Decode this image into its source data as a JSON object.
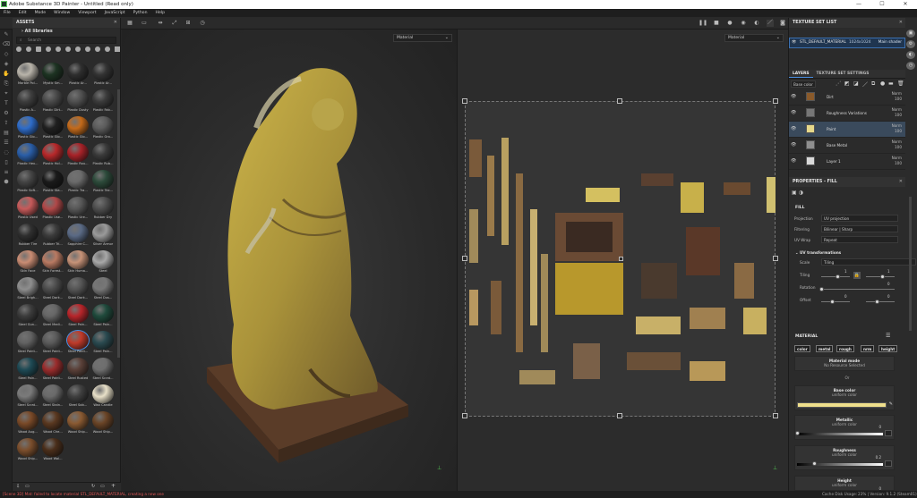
{
  "window": {
    "title": "Adobe Substance 3D Painter - Untitled (Read only)",
    "minimize": "—",
    "maximize": "☐",
    "close": "✕"
  },
  "menu": [
    "File",
    "Edit",
    "Mode",
    "Window",
    "Viewport",
    "JavaScript",
    "Python",
    "Help"
  ],
  "assets": {
    "title": "ASSETS",
    "library": "All libraries",
    "search_placeholder": "Search",
    "items": [
      {
        "label": "Marble Pol...",
        "color": "#b9b4aa"
      },
      {
        "label": "Mystic Sm...",
        "color": "#1d3322"
      },
      {
        "label": "Plastic Ar...",
        "color": "#2e2e2e"
      },
      {
        "label": "Plastic Ar...",
        "color": "#333333"
      },
      {
        "label": "Plastic A...",
        "color": "#3d3d3d"
      },
      {
        "label": "Plastic Dirt...",
        "color": "#4a4a4a"
      },
      {
        "label": "Plastic Dusty",
        "color": "#505050"
      },
      {
        "label": "Plastic Fab...",
        "color": "#3b3b3b"
      },
      {
        "label": "Plastic Glo...",
        "color": "#2e6cc9"
      },
      {
        "label": "Plastic Glo...",
        "color": "#202020"
      },
      {
        "label": "Plastic Glo...",
        "color": "#c46a1a"
      },
      {
        "label": "Plastic Gro...",
        "color": "#5c5c5c"
      },
      {
        "label": "Plastic Hex...",
        "color": "#2a5ea8"
      },
      {
        "label": "Plastic Hol...",
        "color": "#b8282a"
      },
      {
        "label": "Plastic Rou...",
        "color": "#a82228"
      },
      {
        "label": "Plastic Rub...",
        "color": "#3a3a3a"
      },
      {
        "label": "Plastic Soft...",
        "color": "#444444"
      },
      {
        "label": "Plastic Sta...",
        "color": "#1a1a1a"
      },
      {
        "label": "Plastic Tra...",
        "color": "#6b6b6b"
      },
      {
        "label": "Plastic Tex...",
        "color": "#2c4a3a"
      },
      {
        "label": "Plastic Used",
        "color": "#c75a5a"
      },
      {
        "label": "Plastic Use...",
        "color": "#b04848"
      },
      {
        "label": "Plastic Ure...",
        "color": "#575757"
      },
      {
        "label": "Rubber Dry",
        "color": "#4e4e4e"
      },
      {
        "label": "Rubber Tire",
        "color": "#2f2f2f"
      },
      {
        "label": "Rubber Tri...",
        "color": "#3b3b3b"
      },
      {
        "label": "Sapphire C...",
        "color": "#5a6a85"
      },
      {
        "label": "Silver Armor",
        "color": "#9a9a9a"
      },
      {
        "label": "Skin Face",
        "color": "#c98c73"
      },
      {
        "label": "Skin Forest...",
        "color": "#b97a62"
      },
      {
        "label": "Skin Huma...",
        "color": "#c79378"
      },
      {
        "label": "Steel",
        "color": "#a8a8a8"
      },
      {
        "label": "Steel Brigh...",
        "color": "#8e8e8e"
      },
      {
        "label": "Steel Dark...",
        "color": "#4c4c4c"
      },
      {
        "label": "Steel Dark...",
        "color": "#555555"
      },
      {
        "label": "Steel Dus...",
        "color": "#777777"
      },
      {
        "label": "Steel Gun...",
        "color": "#3c3c3c"
      },
      {
        "label": "Steel Medi...",
        "color": "#666666"
      },
      {
        "label": "Steel Pain...",
        "color": "#b8252a"
      },
      {
        "label": "Steel Pain...",
        "color": "#1f4a3c"
      },
      {
        "label": "Steel Paint...",
        "color": "#626262"
      },
      {
        "label": "Steel Paint...",
        "color": "#5a5a5a"
      },
      {
        "label": "Steel Paint...",
        "color": "#c03a2a"
      },
      {
        "label": "Steel Pain...",
        "color": "#2a4a50"
      },
      {
        "label": "Steel Pain...",
        "color": "#1e4a55"
      },
      {
        "label": "Steel Paint...",
        "color": "#9a2c2c"
      },
      {
        "label": "Steel Rusted",
        "color": "#5a4038"
      },
      {
        "label": "Steel Scrat...",
        "color": "#6e6e6e"
      },
      {
        "label": "Steel Scrat...",
        "color": "#7a7a7a"
      },
      {
        "label": "Steel Stain...",
        "color": "#6a6a6a"
      },
      {
        "label": "Steel Sob...",
        "color": "#3f3f3f"
      },
      {
        "label": "Wax Candle",
        "color": "#e8e0c8"
      },
      {
        "label": "Wood Aug...",
        "color": "#7a4a28"
      },
      {
        "label": "Wood Che...",
        "color": "#5a3820"
      },
      {
        "label": "Wood Ship...",
        "color": "#8a5a32"
      },
      {
        "label": "Wood Ship...",
        "color": "#6a4426"
      },
      {
        "label": "Wood Ship...",
        "color": "#7b4e2c"
      },
      {
        "label": "Wood Wal...",
        "color": "#4a2e1a"
      }
    ],
    "selected_index": 42
  },
  "viewport3d": {
    "mode": "Material"
  },
  "viewport2d": {
    "mode": "Material"
  },
  "texture_set_list": {
    "title": "TEXTURE SET LIST",
    "name": "STL_DEFAULT_MATERIAL",
    "resolution": "1024x1024",
    "shader": "Main shader"
  },
  "layers_panel": {
    "tabs": [
      "LAYERS",
      "TEXTURE SET SETTINGS"
    ],
    "channel": "Base color",
    "rows": [
      {
        "name": "Dirt",
        "blend": "Norm",
        "opacity": "100",
        "thumb": "#8a5a2a",
        "selected": false
      },
      {
        "name": "Roughness Variations",
        "blend": "Norm",
        "opacity": "100",
        "thumb": "#777777",
        "selected": false
      },
      {
        "name": "Paint",
        "blend": "Norm",
        "opacity": "100",
        "thumb": "#e6d88a",
        "selected": true
      },
      {
        "name": "Base Metal",
        "blend": "Norm",
        "opacity": "100",
        "thumb": "#8f8f8f",
        "selected": false
      },
      {
        "name": "Layer 1",
        "blend": "Norm",
        "opacity": "100",
        "thumb": "#d9d9d9",
        "selected": false
      }
    ]
  },
  "properties": {
    "title": "PROPERTIES - FILL",
    "fill_label": "FILL",
    "projection_label": "Projection",
    "projection": "UV projection",
    "filtering_label": "Filtering",
    "filtering": "Bilinear | Sharp",
    "uvwrap_label": "UV Wrap",
    "uvwrap": "Repeat",
    "uvtrans_label": "UV transformations",
    "scale_label": "Scale",
    "scale": "Tiling",
    "tiling_label": "Tiling",
    "tiling_value": "1",
    "rotation_label": "Rotation",
    "rotation_value": "0",
    "offset_label": "Offset",
    "offset_x": "0",
    "offset_y": "0",
    "material_label": "MATERIAL",
    "channels": [
      "color",
      "metal",
      "rough",
      "nrm",
      "height"
    ],
    "material_mode_label": "Material mode",
    "material_mode_value": "No Resource Selected",
    "or_label": "Or",
    "basecolor_label": "Base color",
    "basecolor_value": "uniform color",
    "basecolor_swatch": "#f0e08c",
    "metallic_label": "Metallic",
    "metallic_value": "uniform color",
    "metallic_amount": "0",
    "metallic_level": 0,
    "roughness_label": "Roughness",
    "roughness_value": "uniform color",
    "roughness_amount": "0.2",
    "roughness_level": 0.2,
    "height_label": "Height",
    "height_value": "uniform color",
    "height_amount": "0"
  },
  "status": {
    "error": "[Scene 3D] Mat: failed to locate material STL_DEFAULT_MATERIAL, creating a new one",
    "cache": "Cache Disk Usage:",
    "version": "23% | Version: 9.1.2 (Steam01)"
  }
}
